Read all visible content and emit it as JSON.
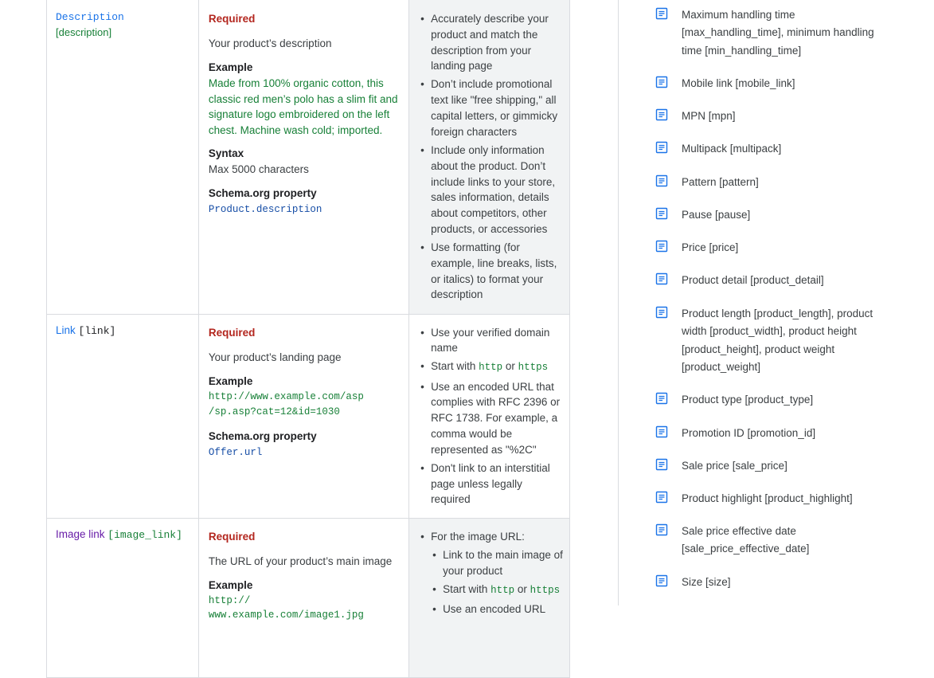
{
  "rows": [
    {
      "name_text": "Description",
      "name_key": "[description]",
      "required": "Required",
      "summary": "Your product’s description",
      "example_label": "Example",
      "example_value": "Made from 100% organic cotton, this classic red men’s polo has a slim fit and signature logo embroidered on the left chest. Machine wash cold; imported.",
      "syntax_label": "Syntax",
      "syntax_value": "Max 5000 characters",
      "schema_label": "Schema.org property",
      "schema_value": "Product.description",
      "bullets": [
        "Accurately describe your product and match the description from your landing page",
        "Don’t include promotional text like \"free shipping,\" all capital letters, or gimmicky foreign characters",
        "Include only information about the product. Don’t include links to your store, sales information, details about competitors, other products, or accessories",
        "Use formatting (for example, line breaks, lists, or italics) to format your description"
      ]
    },
    {
      "name_text": "Link",
      "name_key": "[link]",
      "required": "Required",
      "summary": "Your product’s landing page",
      "example_label": "Example",
      "example_line1": "http://www.example.com/asp",
      "example_line2": "/sp.asp?cat=12&id=1030",
      "schema_label": "Schema.org property",
      "schema_value": "Offer.url",
      "bullets": [
        "Use your verified domain name",
        {
          "prefix": "Start with ",
          "code1": "http",
          "mid": " or ",
          "code2": "https"
        },
        "Use an encoded URL that complies with RFC 2396 or RFC 1738. For example, a comma would be represented as \"%2C\"",
        "Don't link to an interstitial page unless legally required"
      ]
    },
    {
      "name_text": "Image link",
      "name_key": "[image_link]",
      "required": "Required",
      "summary": "The URL of your product’s main image",
      "example_label": "Example",
      "example_line1": "http://",
      "example_line2": "www.example.com/image1.jpg",
      "bullet_intro": "For the image URL:",
      "sub_bullets": [
        "Link to the main image of your product",
        {
          "prefix": "Start with ",
          "code1": "http",
          "mid": " or ",
          "code2": "https"
        },
        "Use an encoded URL"
      ]
    }
  ],
  "toc": [
    {
      "label": "Maximum handling time [max_handling_time], minimum handling time [min_handling_time]",
      "icon": "article-icon"
    },
    {
      "label": "Mobile link [mobile_link]",
      "icon": "article-icon"
    },
    {
      "label": "MPN [mpn]",
      "icon": "article-icon"
    },
    {
      "label": "Multipack [multipack]",
      "icon": "article-icon"
    },
    {
      "label": "Pattern [pattern]",
      "icon": "article-icon"
    },
    {
      "label": "Pause [pause]",
      "icon": "article-icon"
    },
    {
      "label": "Price [price]",
      "icon": "article-icon"
    },
    {
      "label": "Product detail [product_detail]",
      "icon": "article-icon"
    },
    {
      "label": "Product length [product_length], product width [product_width], product height [product_height], product weight [product_weight]",
      "icon": "article-icon"
    },
    {
      "label": "Product type [product_type]",
      "icon": "article-icon"
    },
    {
      "label": "Promotion ID [promotion_id]",
      "icon": "article-icon"
    },
    {
      "label": "Sale price [sale_price]",
      "icon": "article-icon"
    },
    {
      "label": "Product highlight [product_highlight]",
      "icon": "article-icon"
    },
    {
      "label": "Sale price effective date [sale_price_effective_date]",
      "icon": "article-icon"
    },
    {
      "label": "Size [size]",
      "icon": "article-icon"
    }
  ],
  "colors": {
    "accent": "#1a73e8",
    "required": "#b3261e",
    "code_green": "#188038",
    "code_blue": "#174ea6"
  }
}
